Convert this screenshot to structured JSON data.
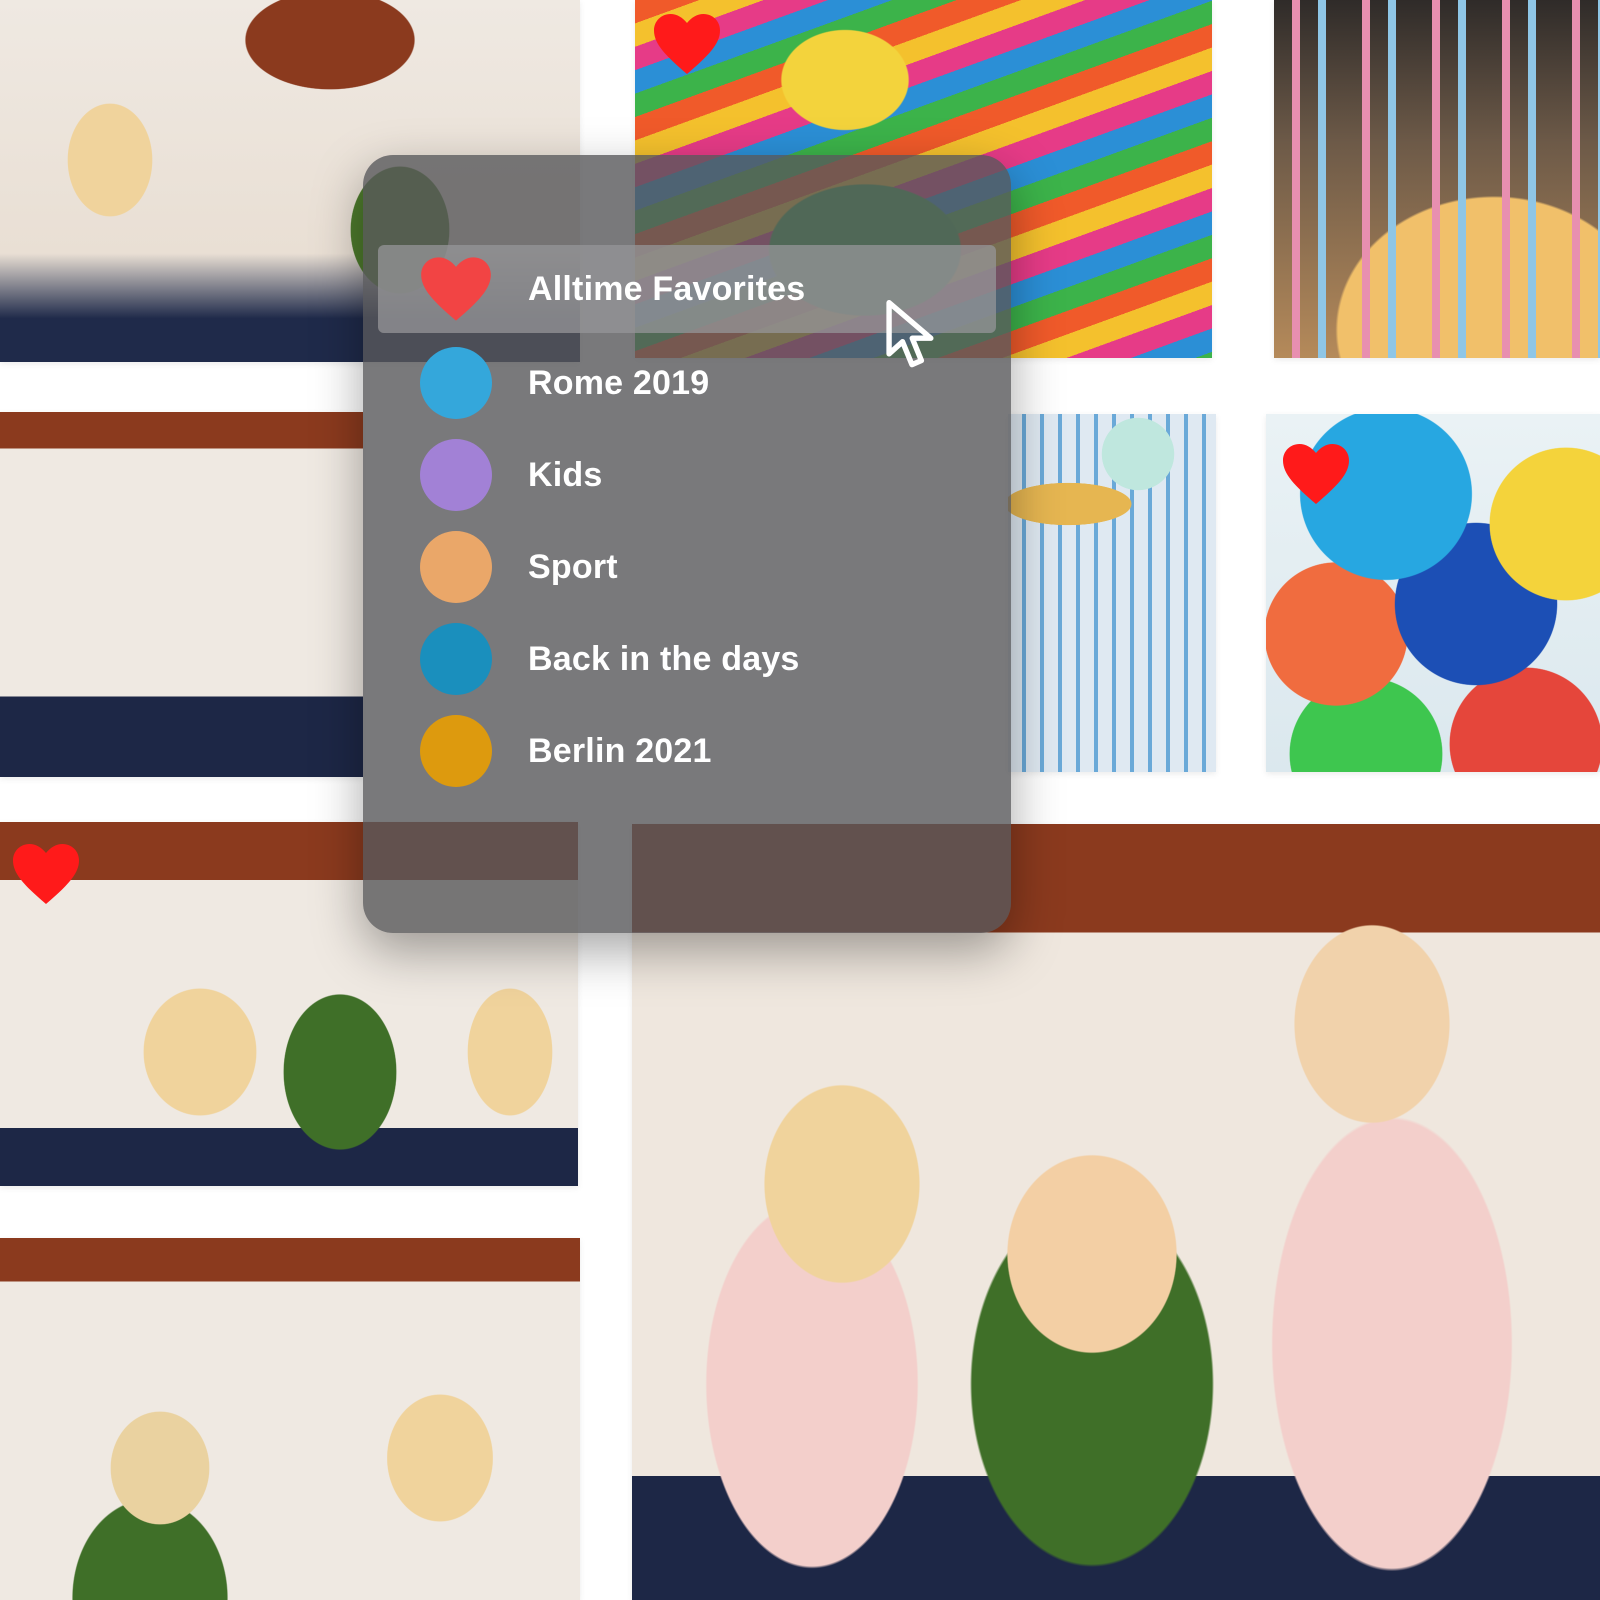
{
  "colors": {
    "favorite_red": "#f24444",
    "badge_red": "#ff1a1a",
    "panel_bg": "#58585a",
    "selected_row": "#969698",
    "label_text": "#ffffff"
  },
  "gallery": {
    "photos": [
      {
        "name": "party-photo-1",
        "favorite": false
      },
      {
        "name": "pinata-photo",
        "favorite": true
      },
      {
        "name": "birthday-cake-photo",
        "favorite": false
      },
      {
        "name": "party-photo-2",
        "favorite": false
      },
      {
        "name": "party-decor-photo",
        "favorite": false
      },
      {
        "name": "balloons-photo",
        "favorite": true
      },
      {
        "name": "party-photo-3",
        "favorite": true
      },
      {
        "name": "party-photo-4",
        "favorite": false
      },
      {
        "name": "party-photo-main",
        "favorite": false
      }
    ]
  },
  "album_menu": {
    "items": [
      {
        "label": "Alltime Favorites",
        "icon": "heart-icon",
        "color": "#f24444",
        "selected": true
      },
      {
        "label": "Rome 2019",
        "icon": "color-dot",
        "color": "#34a7db",
        "selected": false
      },
      {
        "label": "Kids",
        "icon": "color-dot",
        "color": "#a281d6",
        "selected": false
      },
      {
        "label": "Sport",
        "icon": "color-dot",
        "color": "#eaa769",
        "selected": false
      },
      {
        "label": "Back in the days",
        "icon": "color-dot",
        "color": "#1a8fbd",
        "selected": false
      },
      {
        "label": "Berlin 2021",
        "icon": "color-dot",
        "color": "#dd9a0e",
        "selected": false
      }
    ],
    "cursor_icon": "mouse-pointer-icon"
  }
}
